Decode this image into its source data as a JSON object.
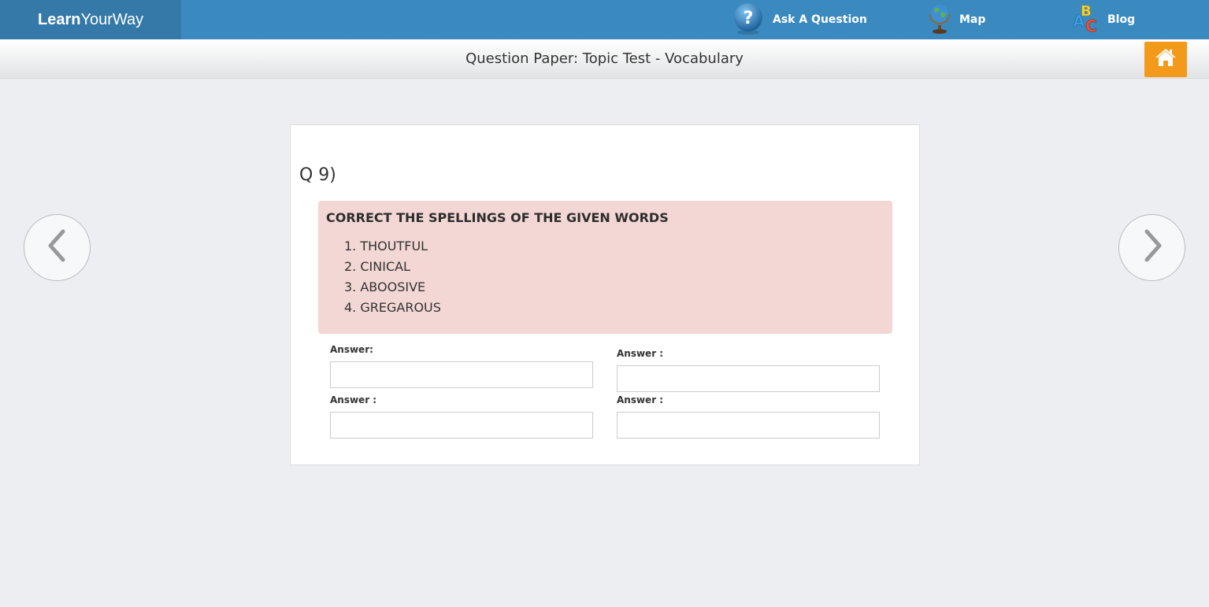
{
  "header": {
    "logo_bold": "Learn",
    "logo_light": "YourWay",
    "nav": [
      {
        "label": "Ask A Question",
        "icon": "question-icon"
      },
      {
        "label": "Map",
        "icon": "globe-icon"
      },
      {
        "label": "Blog",
        "icon": "abc-blocks-icon"
      }
    ]
  },
  "subheader": {
    "title": "Question Paper: Topic Test - Vocabulary",
    "home_icon": "home-icon"
  },
  "question": {
    "number": "Q 9)",
    "title": "CORRECT THE SPELLINGS OF THE GIVEN WORDS",
    "items": [
      {
        "num": "1.",
        "text": "THOUTFUL"
      },
      {
        "num": "2.",
        "text": "CINICAL"
      },
      {
        "num": "3.",
        "text": "ABOOSIVE"
      },
      {
        "num": "4.",
        "text": "GREGAROUS"
      }
    ]
  },
  "answers": [
    {
      "label": "Answer:",
      "value": ""
    },
    {
      "label": "Answer :",
      "value": ""
    },
    {
      "label": "Answer :",
      "value": ""
    },
    {
      "label": "Answer :",
      "value": ""
    }
  ],
  "colors": {
    "topbar": "#3a8ac0",
    "home_button": "#f39a1a",
    "question_box": "#f2d7d4"
  }
}
